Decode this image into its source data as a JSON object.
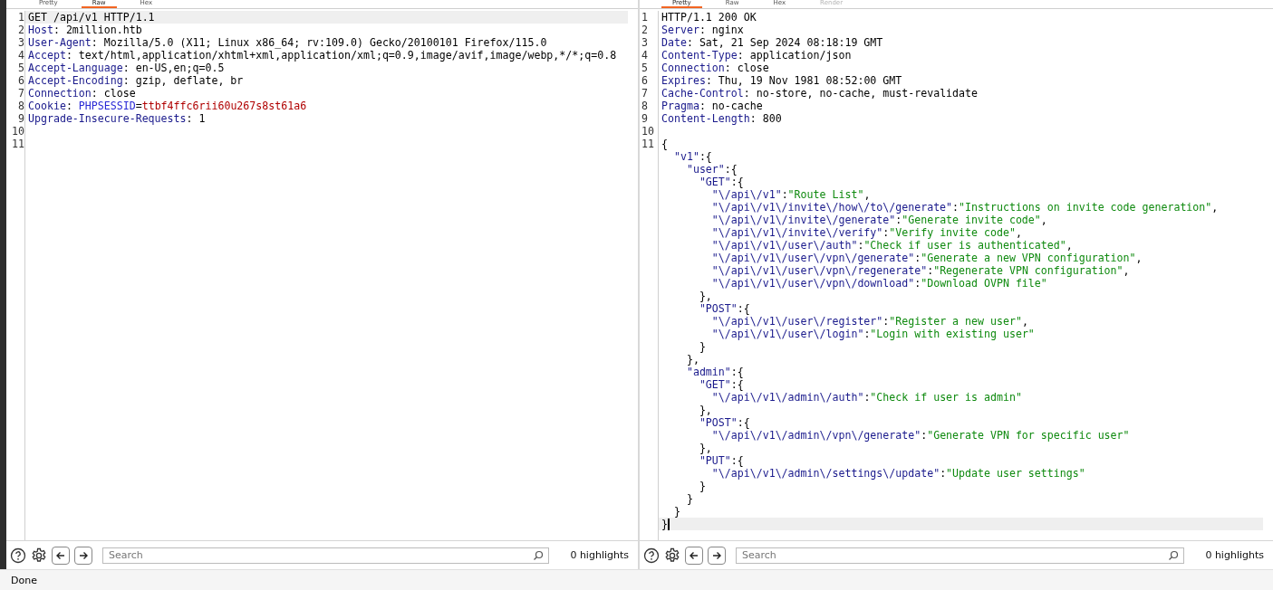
{
  "panes": [
    {
      "kind": "request",
      "focused": false,
      "tabs": [
        {
          "label": "Pretty",
          "selected": false,
          "disabled": false
        },
        {
          "label": "Raw",
          "selected": true,
          "disabled": false
        },
        {
          "label": "Hex",
          "selected": false,
          "disabled": false
        }
      ],
      "lines": [
        {
          "number": "1",
          "current": true,
          "segments": [
            {
              "kind": "plain",
              "text": "GET /api/v1 HTTP/1.1"
            }
          ]
        },
        {
          "number": "2",
          "current": false,
          "segments": [
            {
              "kind": "name",
              "text": "Host"
            },
            {
              "kind": "plain",
              "text": ": 2million.htb"
            }
          ]
        },
        {
          "number": "3",
          "current": false,
          "segments": [
            {
              "kind": "name",
              "text": "User-Agent"
            },
            {
              "kind": "plain",
              "text": ": Mozilla/5.0 (X11; Linux x86_64; rv:109.0) Gecko/20100101 Firefox/115.0"
            }
          ]
        },
        {
          "number": "4",
          "current": false,
          "segments": [
            {
              "kind": "name",
              "text": "Accept"
            },
            {
              "kind": "plain",
              "text": ": text/html,application/xhtml+xml,application/xml;q=0.9,image/avif,image/webp,*/*;q=0.8"
            }
          ]
        },
        {
          "number": "5",
          "current": false,
          "segments": [
            {
              "kind": "name",
              "text": "Accept-Language"
            },
            {
              "kind": "plain",
              "text": ": en-US,en;q=0.5"
            }
          ]
        },
        {
          "number": "6",
          "current": false,
          "segments": [
            {
              "kind": "name",
              "text": "Accept-Encoding"
            },
            {
              "kind": "plain",
              "text": ": gzip, deflate, br"
            }
          ]
        },
        {
          "number": "7",
          "current": false,
          "segments": [
            {
              "kind": "name",
              "text": "Connection"
            },
            {
              "kind": "plain",
              "text": ": close"
            }
          ]
        },
        {
          "number": "8",
          "current": false,
          "segments": [
            {
              "kind": "name",
              "text": "Cookie"
            },
            {
              "kind": "plain",
              "text": ": "
            },
            {
              "kind": "param",
              "text": "PHPSESSID"
            },
            {
              "kind": "plain",
              "text": "="
            },
            {
              "kind": "value",
              "text": "ttbf4ffc6rii60u267s8st61a6"
            }
          ]
        },
        {
          "number": "9",
          "current": false,
          "segments": [
            {
              "kind": "name",
              "text": "Upgrade-Insecure-Requests"
            },
            {
              "kind": "plain",
              "text": ": 1"
            }
          ]
        },
        {
          "number": "10",
          "current": false
        },
        {
          "number": "11",
          "current": false
        }
      ],
      "search": {
        "placeholder": "Search"
      },
      "highlights": "0 highlights"
    },
    {
      "kind": "response",
      "focused": true,
      "tabs": [
        {
          "label": "Pretty",
          "selected": true,
          "disabled": false
        },
        {
          "label": "Raw",
          "selected": false,
          "disabled": false
        },
        {
          "label": "Hex",
          "selected": false,
          "disabled": false
        },
        {
          "label": "Render",
          "selected": false,
          "disabled": true
        }
      ],
      "lines": [
        {
          "number": "1",
          "current": false,
          "segments": [
            {
              "kind": "plain",
              "text": "HTTP/1.1 200 OK"
            }
          ]
        },
        {
          "number": "2",
          "current": false,
          "segments": [
            {
              "kind": "name",
              "text": "Server"
            },
            {
              "kind": "plain",
              "text": ": nginx"
            }
          ]
        },
        {
          "number": "3",
          "current": false,
          "segments": [
            {
              "kind": "name",
              "text": "Date"
            },
            {
              "kind": "plain",
              "text": ": Sat, 21 Sep 2024 08:18:19 GMT"
            }
          ]
        },
        {
          "number": "4",
          "current": false,
          "segments": [
            {
              "kind": "name",
              "text": "Content-Type"
            },
            {
              "kind": "plain",
              "text": ": application/json"
            }
          ]
        },
        {
          "number": "5",
          "current": false,
          "segments": [
            {
              "kind": "name",
              "text": "Connection"
            },
            {
              "kind": "plain",
              "text": ": close"
            }
          ]
        },
        {
          "number": "6",
          "current": false,
          "segments": [
            {
              "kind": "name",
              "text": "Expires"
            },
            {
              "kind": "plain",
              "text": ": Thu, 19 Nov 1981 08:52:00 GMT"
            }
          ]
        },
        {
          "number": "7",
          "current": false,
          "segments": [
            {
              "kind": "name",
              "text": "Cache-Control"
            },
            {
              "kind": "plain",
              "text": ": no-store, no-cache, must-revalidate"
            }
          ]
        },
        {
          "number": "8",
          "current": false,
          "segments": [
            {
              "kind": "name",
              "text": "Pragma"
            },
            {
              "kind": "plain",
              "text": ": no-cache"
            }
          ]
        },
        {
          "number": "9",
          "current": false,
          "segments": [
            {
              "kind": "name",
              "text": "Content-Length"
            },
            {
              "kind": "plain",
              "text": ": 800"
            }
          ]
        },
        {
          "number": "10",
          "current": false
        },
        {
          "number": "11",
          "current": false,
          "segments": [
            {
              "kind": "plain",
              "text": "{"
            }
          ]
        },
        {
          "current": false,
          "segments": [
            {
              "kind": "name",
              "text": "  \"v1\""
            },
            {
              "kind": "plain",
              "text": ":{"
            }
          ]
        },
        {
          "current": false,
          "segments": [
            {
              "kind": "name",
              "text": "    \"user\""
            },
            {
              "kind": "plain",
              "text": ":{"
            }
          ]
        },
        {
          "current": false,
          "segments": [
            {
              "kind": "name",
              "text": "      \"GET\""
            },
            {
              "kind": "plain",
              "text": ":{"
            }
          ]
        },
        {
          "current": false,
          "segments": [
            {
              "kind": "name",
              "text": "        \"\\/api\\/v1\""
            },
            {
              "kind": "plain",
              "text": ":"
            },
            {
              "kind": "string",
              "text": "\"Route List\""
            },
            {
              "kind": "plain",
              "text": ","
            }
          ]
        },
        {
          "current": false,
          "segments": [
            {
              "kind": "name",
              "text": "        \"\\/api\\/v1\\/invite\\/how\\/to\\/generate\""
            },
            {
              "kind": "plain",
              "text": ":"
            },
            {
              "kind": "string",
              "text": "\"Instructions on invite code generation\""
            },
            {
              "kind": "plain",
              "text": ","
            }
          ]
        },
        {
          "current": false,
          "segments": [
            {
              "kind": "name",
              "text": "        \"\\/api\\/v1\\/invite\\/generate\""
            },
            {
              "kind": "plain",
              "text": ":"
            },
            {
              "kind": "string",
              "text": "\"Generate invite code\""
            },
            {
              "kind": "plain",
              "text": ","
            }
          ]
        },
        {
          "current": false,
          "segments": [
            {
              "kind": "name",
              "text": "        \"\\/api\\/v1\\/invite\\/verify\""
            },
            {
              "kind": "plain",
              "text": ":"
            },
            {
              "kind": "string",
              "text": "\"Verify invite code\""
            },
            {
              "kind": "plain",
              "text": ","
            }
          ]
        },
        {
          "current": false,
          "segments": [
            {
              "kind": "name",
              "text": "        \"\\/api\\/v1\\/user\\/auth\""
            },
            {
              "kind": "plain",
              "text": ":"
            },
            {
              "kind": "string",
              "text": "\"Check if user is authenticated\""
            },
            {
              "kind": "plain",
              "text": ","
            }
          ]
        },
        {
          "current": false,
          "segments": [
            {
              "kind": "name",
              "text": "        \"\\/api\\/v1\\/user\\/vpn\\/generate\""
            },
            {
              "kind": "plain",
              "text": ":"
            },
            {
              "kind": "string",
              "text": "\"Generate a new VPN configuration\""
            },
            {
              "kind": "plain",
              "text": ","
            }
          ]
        },
        {
          "current": false,
          "segments": [
            {
              "kind": "name",
              "text": "        \"\\/api\\/v1\\/user\\/vpn\\/regenerate\""
            },
            {
              "kind": "plain",
              "text": ":"
            },
            {
              "kind": "string",
              "text": "\"Regenerate VPN configuration\""
            },
            {
              "kind": "plain",
              "text": ","
            }
          ]
        },
        {
          "current": false,
          "segments": [
            {
              "kind": "name",
              "text": "        \"\\/api\\/v1\\/user\\/vpn\\/download\""
            },
            {
              "kind": "plain",
              "text": ":"
            },
            {
              "kind": "string",
              "text": "\"Download OVPN file\""
            }
          ]
        },
        {
          "current": false,
          "segments": [
            {
              "kind": "plain",
              "text": "      },"
            }
          ]
        },
        {
          "current": false,
          "segments": [
            {
              "kind": "name",
              "text": "      \"POST\""
            },
            {
              "kind": "plain",
              "text": ":{"
            }
          ]
        },
        {
          "current": false,
          "segments": [
            {
              "kind": "name",
              "text": "        \"\\/api\\/v1\\/user\\/register\""
            },
            {
              "kind": "plain",
              "text": ":"
            },
            {
              "kind": "string",
              "text": "\"Register a new user\""
            },
            {
              "kind": "plain",
              "text": ","
            }
          ]
        },
        {
          "current": false,
          "segments": [
            {
              "kind": "name",
              "text": "        \"\\/api\\/v1\\/user\\/login\""
            },
            {
              "kind": "plain",
              "text": ":"
            },
            {
              "kind": "string",
              "text": "\"Login with existing user\""
            }
          ]
        },
        {
          "current": false,
          "segments": [
            {
              "kind": "plain",
              "text": "      }"
            }
          ]
        },
        {
          "current": false,
          "segments": [
            {
              "kind": "plain",
              "text": "    },"
            }
          ]
        },
        {
          "current": false,
          "segments": [
            {
              "kind": "name",
              "text": "    \"admin\""
            },
            {
              "kind": "plain",
              "text": ":{"
            }
          ]
        },
        {
          "current": false,
          "segments": [
            {
              "kind": "name",
              "text": "      \"GET\""
            },
            {
              "kind": "plain",
              "text": ":{"
            }
          ]
        },
        {
          "current": false,
          "segments": [
            {
              "kind": "name",
              "text": "        \"\\/api\\/v1\\/admin\\/auth\""
            },
            {
              "kind": "plain",
              "text": ":"
            },
            {
              "kind": "string",
              "text": "\"Check if user is admin\""
            }
          ]
        },
        {
          "current": false,
          "segments": [
            {
              "kind": "plain",
              "text": "      },"
            }
          ]
        },
        {
          "current": false,
          "segments": [
            {
              "kind": "name",
              "text": "      \"POST\""
            },
            {
              "kind": "plain",
              "text": ":{"
            }
          ]
        },
        {
          "current": false,
          "segments": [
            {
              "kind": "name",
              "text": "        \"\\/api\\/v1\\/admin\\/vpn\\/generate\""
            },
            {
              "kind": "plain",
              "text": ":"
            },
            {
              "kind": "string",
              "text": "\"Generate VPN for specific user\""
            }
          ]
        },
        {
          "current": false,
          "segments": [
            {
              "kind": "plain",
              "text": "      },"
            }
          ]
        },
        {
          "current": false,
          "segments": [
            {
              "kind": "name",
              "text": "      \"PUT\""
            },
            {
              "kind": "plain",
              "text": ":{"
            }
          ]
        },
        {
          "current": false,
          "segments": [
            {
              "kind": "name",
              "text": "        \"\\/api\\/v1\\/admin\\/settings\\/update\""
            },
            {
              "kind": "plain",
              "text": ":"
            },
            {
              "kind": "string",
              "text": "\"Update user settings\""
            }
          ]
        },
        {
          "current": false,
          "segments": [
            {
              "kind": "plain",
              "text": "      }"
            }
          ]
        },
        {
          "current": false,
          "segments": [
            {
              "kind": "plain",
              "text": "    }"
            }
          ]
        },
        {
          "current": false,
          "segments": [
            {
              "kind": "plain",
              "text": "  }"
            }
          ]
        },
        {
          "current": true,
          "segments": [
            {
              "kind": "plain",
              "text": "}"
            }
          ]
        }
      ],
      "search": {
        "placeholder": "Search"
      },
      "highlights": "0 highlights"
    }
  ],
  "status_bar": "Done"
}
